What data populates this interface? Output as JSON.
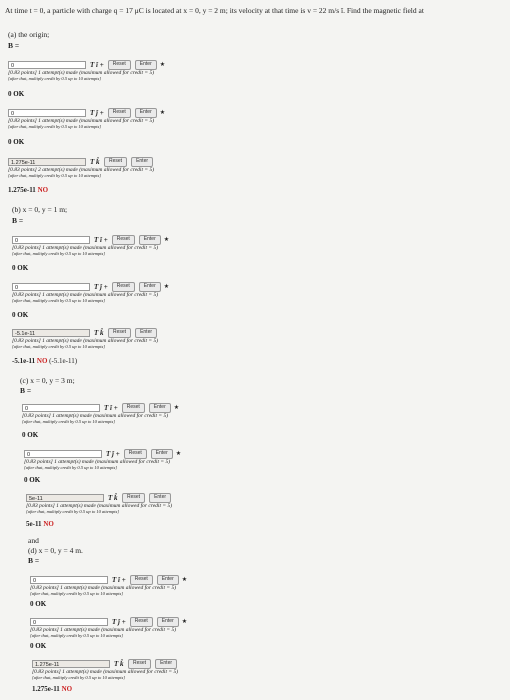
{
  "problem_text": "At time t = 0, a particle with charge q = 17 μC is located at x = 0, y = 2 m; its velocity at that time is v = 22 m/s î. Find the magnetic field at",
  "buttons": {
    "reset": "Reset",
    "enter": "Enter"
  },
  "b_label": "B =",
  "parts": [
    {
      "label": "(a) the origin;",
      "fields": [
        {
          "value": "0",
          "unit": "T î +",
          "star": true,
          "meta": "[0.83 points] 1 attempt(s) made (maximum allowed for credit = 5)",
          "sub": "[after that, multiply credit by 0.5 up to 10 attempts]",
          "result": "0",
          "status": "OK",
          "extra": ""
        },
        {
          "value": "0",
          "unit": "T ĵ +",
          "star": true,
          "meta": "[0.83 points] 1 attempt(s) made (maximum allowed for credit = 5)",
          "sub": "[after that, multiply credit by 0.5 up to 10 attempts]",
          "result": "0",
          "status": "OK",
          "extra": ""
        },
        {
          "value": "1.275e-11",
          "unit": "T k̂",
          "star": false,
          "meta": "[0.83 points] 2 attempt(s) made (maximum allowed for credit = 5)",
          "sub": "[after that, multiply credit by 0.5 up to 10 attempts]",
          "result": "1.275e-11",
          "status": "NO",
          "extra": ""
        }
      ]
    },
    {
      "label": "(b) x = 0, y = 1 m;",
      "fields": [
        {
          "value": "0",
          "unit": "T î +",
          "star": true,
          "meta": "[0.83 points] 1 attempt(s) made (maximum allowed for credit = 5)",
          "sub": "[after that, multiply credit by 0.5 up to 10 attempts]",
          "result": "0",
          "status": "OK",
          "extra": ""
        },
        {
          "value": "0",
          "unit": "T ĵ +",
          "star": true,
          "meta": "[0.83 points] 1 attempt(s) made (maximum allowed for credit = 5)",
          "sub": "[after that, multiply credit by 0.5 up to 10 attempts]",
          "result": "0",
          "status": "OK",
          "extra": ""
        },
        {
          "value": "-5.1e-11",
          "unit": "T k̂",
          "star": false,
          "meta": "[0.83 points] 1 attempt(s) made (maximum allowed for credit = 5)",
          "sub": "[after that, multiply credit by 0.5 up to 10 attempts]",
          "result": "-5.1e-11",
          "status": "NO",
          "extra": "(-5.1e-11)"
        }
      ]
    },
    {
      "label": "(c) x = 0, y = 3 m;",
      "fields": [
        {
          "value": "0",
          "unit": "T î +",
          "star": true,
          "meta": "[0.83 points] 1 attempt(s) made (maximum allowed for credit = 5)",
          "sub": "[after that, multiply credit by 0.5 up to 10 attempts]",
          "result": "0",
          "status": "OK",
          "extra": ""
        },
        {
          "value": "0",
          "unit": "T ĵ +",
          "star": true,
          "meta": "[0.83 points] 1 attempt(s) made (maximum allowed for credit = 5)",
          "sub": "[after that, multiply credit by 0.5 up to 10 attempts]",
          "result": "0",
          "status": "OK",
          "extra": ""
        },
        {
          "value": "5e-11",
          "unit": "T k̂",
          "star": false,
          "meta": "[0.83 points] 1 attempt(s) made (maximum allowed for credit = 5)",
          "sub": "[after that, multiply credit by 0.5 up to 10 attempts]",
          "result": "5e-11",
          "status": "NO",
          "extra": ""
        }
      ]
    },
    {
      "prefix": "and",
      "label": "(d) x = 0, y = 4 m.",
      "fields": [
        {
          "value": "0",
          "unit": "T î +",
          "star": true,
          "meta": "[0.83 points] 1 attempt(s) made (maximum allowed for credit = 5)",
          "sub": "[after that, multiply credit by 0.5 up to 10 attempts]",
          "result": "0",
          "status": "OK",
          "extra": ""
        },
        {
          "value": "0",
          "unit": "T ĵ +",
          "star": true,
          "meta": "[0.83 points] 1 attempt(s) made (maximum allowed for credit = 5)",
          "sub": "[after that, multiply credit by 0.5 up to 10 attempts]",
          "result": "0",
          "status": "OK",
          "extra": ""
        },
        {
          "value": "1.275e-11",
          "unit": "T k̂",
          "star": false,
          "meta": "[0.83 points] 1 attempt(s) made (maximum allowed for credit = 5)",
          "sub": "[after that, multiply credit by 0.5 up to 10 attempts]",
          "result": "1.275e-11",
          "status": "NO",
          "extra": ""
        }
      ]
    }
  ]
}
